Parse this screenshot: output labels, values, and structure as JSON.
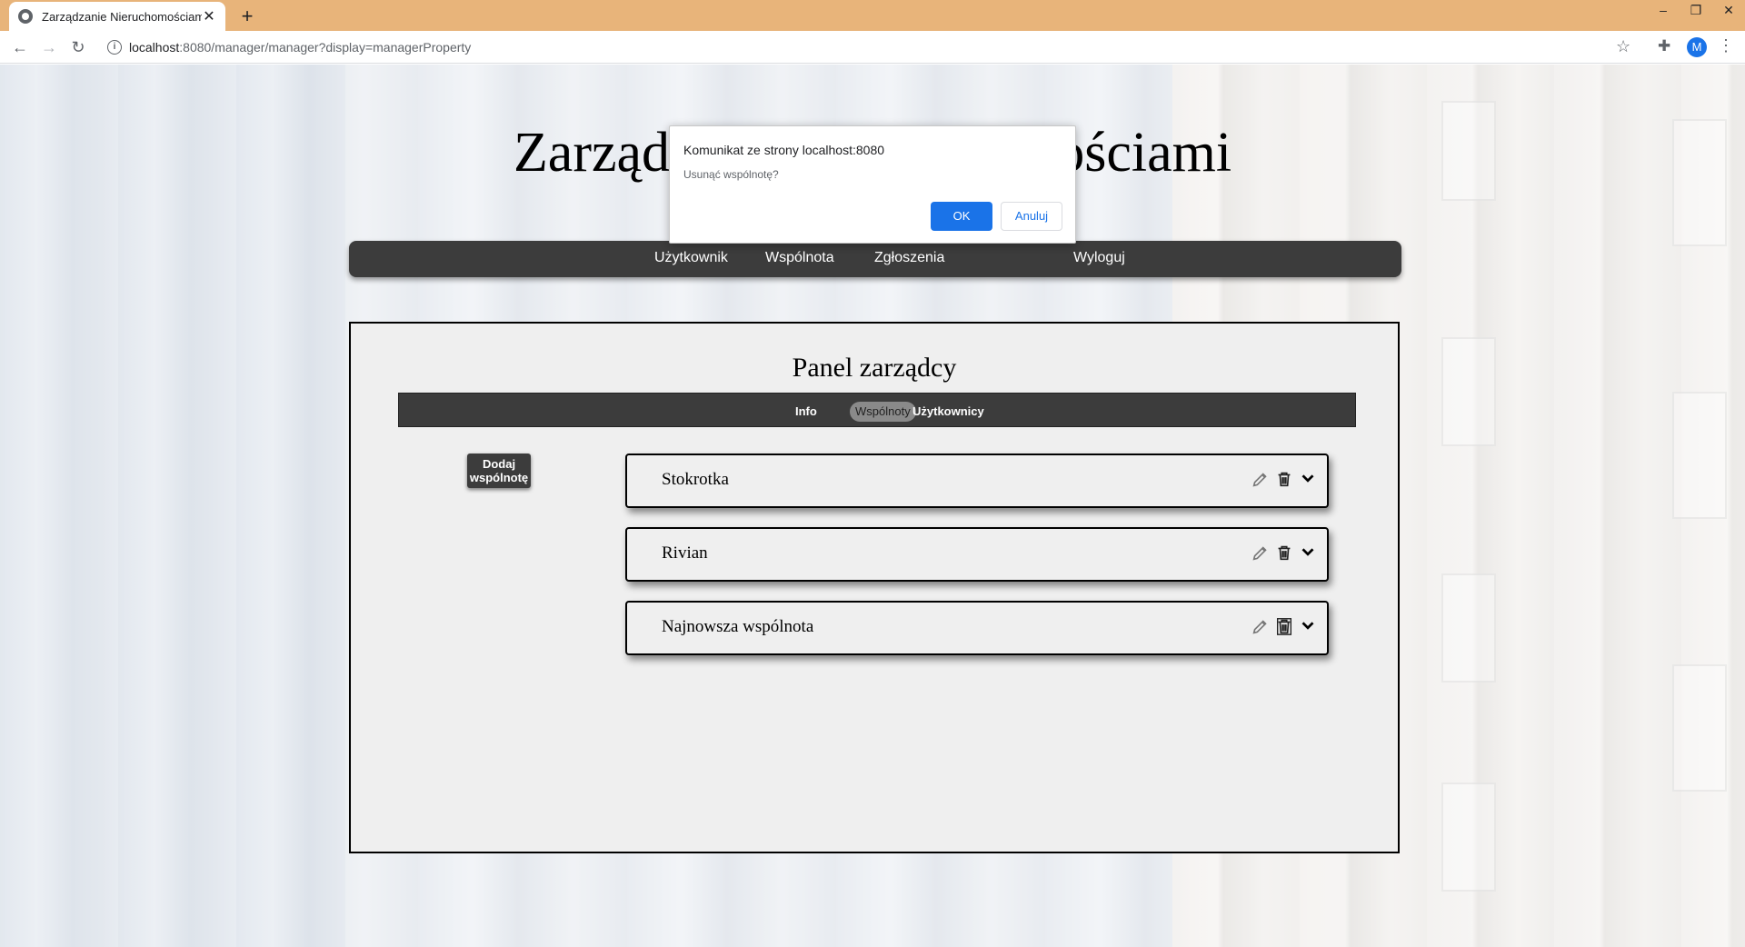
{
  "browser": {
    "tab_title": "Zarządzanie Nieruchomościami",
    "tab_close": "✕",
    "new_tab": "+",
    "url_host": "localhost",
    "url_rest": ":8080/manager/manager?display=managerProperty",
    "avatar_letter": "M",
    "window_controls": [
      "–",
      "❐",
      "✕"
    ]
  },
  "site": {
    "title": "Zarządzanie Nieruchomościami",
    "nav": [
      "Użytkownik",
      "Wspólnota",
      "Zgłoszenia",
      "Wyloguj"
    ]
  },
  "panel": {
    "title": "Panel zarządcy",
    "subnav": [
      "Info",
      "Wspólnoty",
      "Użytkownicy"
    ],
    "active_subnav": "Wspólnoty",
    "add_button": "Dodaj wspólnotę",
    "communities": [
      "Stokrotka",
      "Rivian",
      "Najnowsza wspólnota"
    ]
  },
  "dialog": {
    "title": "Komunikat ze strony localhost:8080",
    "message": "Usunąć wspólnotę?",
    "ok": "OK",
    "cancel": "Anuluj"
  },
  "colors": {
    "titlebar": "#e8b47a",
    "nav_bg": "#3c3c3c",
    "dialog_accent": "#1a73e8"
  }
}
